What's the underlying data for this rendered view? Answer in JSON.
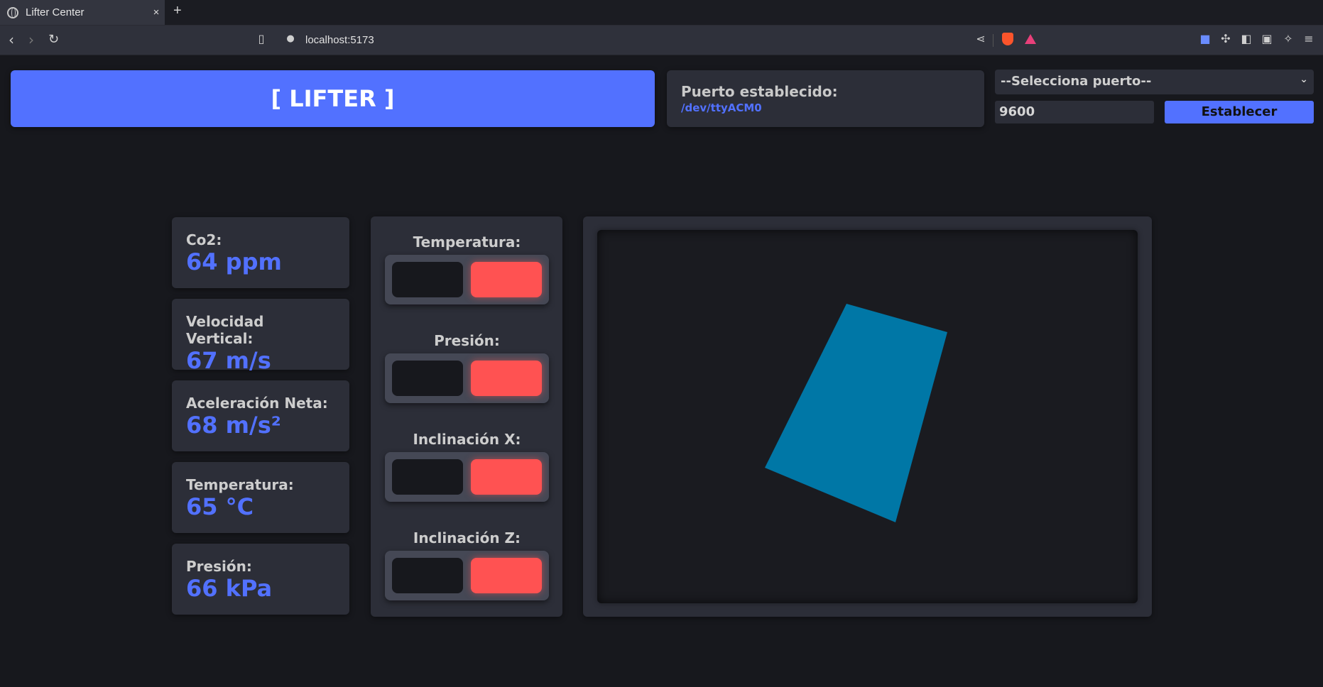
{
  "browser": {
    "tab_title": "Lifter Center",
    "tab_close": "×",
    "new_tab": "+",
    "url": "localhost:5173"
  },
  "header": {
    "title": "[ LIFTER ]"
  },
  "port": {
    "label": "Puerto establecido:",
    "value": "/dev/ttyACM0",
    "select_value": "--Selecciona puerto--",
    "baud": "9600",
    "set_label": "Establecer"
  },
  "metrics": [
    {
      "label": "Co2:",
      "value": "64 ppm"
    },
    {
      "label": "Velocidad Vertical:",
      "value": "67 m/s"
    },
    {
      "label": "Aceleración Neta:",
      "value": "68 m/s²"
    },
    {
      "label": "Temperatura:",
      "value": "65 °C"
    },
    {
      "label": "Presión:",
      "value": "66 kPa"
    }
  ],
  "status": [
    {
      "label": "Temperatura:"
    },
    {
      "label": "Presión:"
    },
    {
      "label": "Inclinación X:"
    },
    {
      "label": "Inclinación Z:"
    }
  ],
  "colors": {
    "accent": "#5271ff",
    "alert": "#ff5252",
    "panel": "#2c2e38",
    "background": "#17181d",
    "object": "#0077a6"
  },
  "icons": [
    "globe-icon",
    "back-icon",
    "forward-icon",
    "reload-icon",
    "bookmark-icon",
    "info-icon",
    "share-icon",
    "brave-shields-icon",
    "brave-rewards-icon",
    "extension-icon",
    "puzzle-icon",
    "sidebar-icon",
    "wallet-icon",
    "leo-icon",
    "menu-icon"
  ]
}
